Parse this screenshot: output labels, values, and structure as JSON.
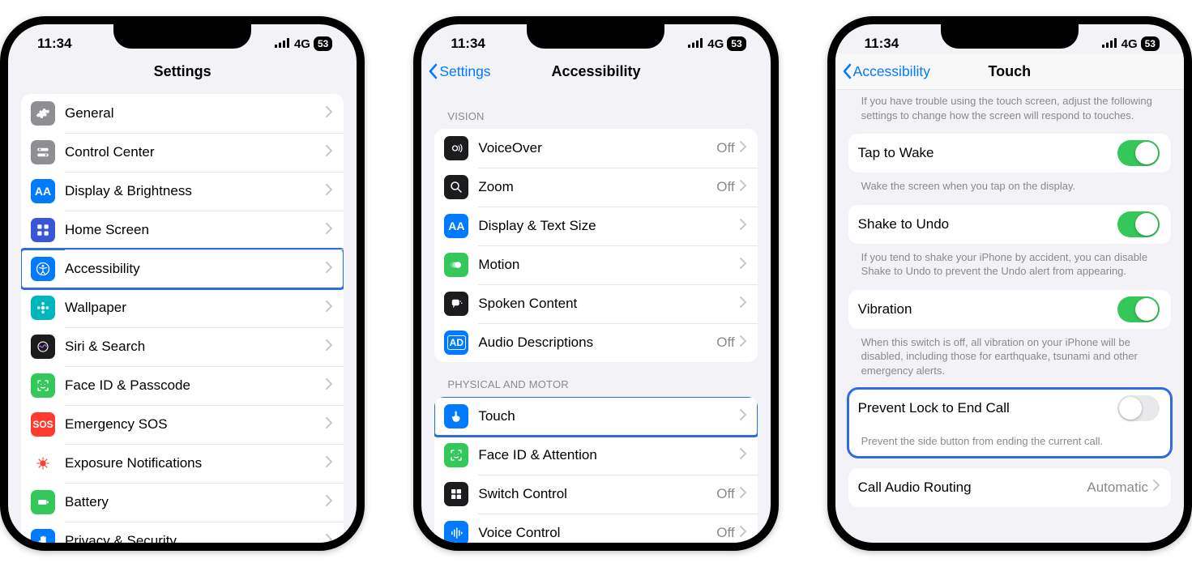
{
  "status": {
    "time": "11:34",
    "network": "4G",
    "battery_pct": "53"
  },
  "phone1": {
    "title": "Settings",
    "rows": [
      {
        "id": "general",
        "label": "General",
        "icon": "gear",
        "bg": "#8e8e93"
      },
      {
        "id": "control-center",
        "label": "Control Center",
        "icon": "switches",
        "bg": "#8e8e93"
      },
      {
        "id": "display",
        "label": "Display & Brightness",
        "icon": "aa",
        "bg": "#007aff"
      },
      {
        "id": "home-screen",
        "label": "Home Screen",
        "icon": "grid",
        "bg": "#3a56d8"
      },
      {
        "id": "accessibility",
        "label": "Accessibility",
        "icon": "access",
        "bg": "#007aff",
        "highlight": true
      },
      {
        "id": "wallpaper",
        "label": "Wallpaper",
        "icon": "flower",
        "bg": "#00b6bd"
      },
      {
        "id": "siri",
        "label": "Siri & Search",
        "icon": "siri",
        "bg": "#1c1c1e"
      },
      {
        "id": "faceid",
        "label": "Face ID & Passcode",
        "icon": "face",
        "bg": "#34c759"
      },
      {
        "id": "sos",
        "label": "Emergency SOS",
        "icon": "sos",
        "bg": "#ff3b30"
      },
      {
        "id": "exposure",
        "label": "Exposure Notifications",
        "icon": "virus",
        "bg": "#ffffff",
        "fg": "#ff3b30"
      },
      {
        "id": "battery",
        "label": "Battery",
        "icon": "battery",
        "bg": "#34c759"
      },
      {
        "id": "privacy",
        "label": "Privacy & Security",
        "icon": "hand",
        "bg": "#007aff"
      }
    ]
  },
  "phone2": {
    "back": "Settings",
    "title": "Accessibility",
    "vision_header": "VISION",
    "vision": [
      {
        "id": "voiceover",
        "label": "VoiceOver",
        "icon": "voiceover",
        "bg": "#1c1c1e",
        "value": "Off"
      },
      {
        "id": "zoom",
        "label": "Zoom",
        "icon": "zoom",
        "bg": "#1c1c1e",
        "value": "Off"
      },
      {
        "id": "display-text",
        "label": "Display & Text Size",
        "icon": "aa",
        "bg": "#007aff"
      },
      {
        "id": "motion",
        "label": "Motion",
        "icon": "motion",
        "bg": "#34c759"
      },
      {
        "id": "spoken",
        "label": "Spoken Content",
        "icon": "speech",
        "bg": "#1c1c1e"
      },
      {
        "id": "audio-desc",
        "label": "Audio Descriptions",
        "icon": "ad",
        "bg": "#007aff",
        "value": "Off"
      }
    ],
    "physical_header": "PHYSICAL AND MOTOR",
    "physical": [
      {
        "id": "touch",
        "label": "Touch",
        "icon": "touch",
        "bg": "#007aff",
        "highlight": true
      },
      {
        "id": "face-attn",
        "label": "Face ID & Attention",
        "icon": "face",
        "bg": "#34c759"
      },
      {
        "id": "switch-ctrl",
        "label": "Switch Control",
        "icon": "switch",
        "bg": "#1c1c1e",
        "value": "Off"
      },
      {
        "id": "voice-ctrl",
        "label": "Voice Control",
        "icon": "voice",
        "bg": "#007aff",
        "value": "Off"
      }
    ]
  },
  "phone3": {
    "back": "Accessibility",
    "title": "Touch",
    "intro_note": "If you have trouble using the touch screen, adjust the following settings to change how the screen will respond to touches.",
    "tap_to_wake": {
      "label": "Tap to Wake",
      "on": true,
      "note": "Wake the screen when you tap on the display."
    },
    "shake_undo": {
      "label": "Shake to Undo",
      "on": true,
      "note": "If you tend to shake your iPhone by accident, you can disable Shake to Undo to prevent the Undo alert from appearing."
    },
    "vibration": {
      "label": "Vibration",
      "on": true,
      "note": "When this switch is off, all vibration on your iPhone will be disabled, including those for earthquake, tsunami and other emergency alerts."
    },
    "prevent_lock": {
      "label": "Prevent Lock to End Call",
      "on": false,
      "note": "Prevent the side button from ending the current call.",
      "highlight": true
    },
    "call_audio": {
      "label": "Call Audio Routing",
      "value": "Automatic"
    }
  }
}
